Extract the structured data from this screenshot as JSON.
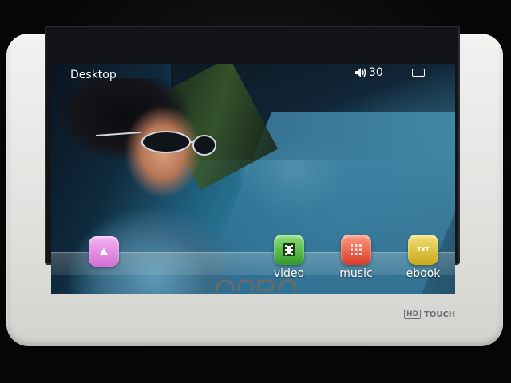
{
  "status_bar": {
    "title": "Desktop",
    "volume_level": "30",
    "volume_icon": "speaker-icon",
    "battery_icon": "battery-icon"
  },
  "dock": {
    "menu_icon": "triangle-up-icon",
    "apps": [
      {
        "label": "video",
        "icon": "film-icon",
        "color": "#3ea832"
      },
      {
        "label": "music",
        "icon": "grid-icon",
        "color": "#e04a30"
      },
      {
        "label": "ebook",
        "icon": "book-icon",
        "color": "#d4b321"
      }
    ],
    "ebook_glyph": "TXT"
  },
  "device": {
    "hd_badge": "HD",
    "touch_label": "TOUCH"
  }
}
